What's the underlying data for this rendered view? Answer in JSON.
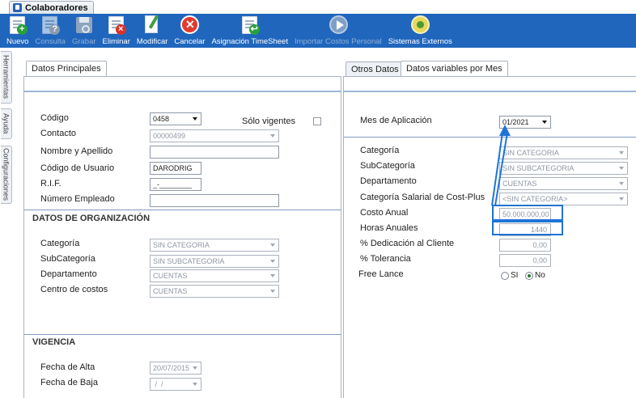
{
  "window": {
    "title": "Colaboradores"
  },
  "toolbar": [
    {
      "label": "Nuevo",
      "enabled": true,
      "icon": "new-doc-icon"
    },
    {
      "label": "Consulta",
      "enabled": false,
      "icon": "query-doc-icon"
    },
    {
      "label": "Grabar",
      "enabled": false,
      "icon": "floppy-icon"
    },
    {
      "label": "Eliminar",
      "enabled": true,
      "icon": "delete-doc-icon"
    },
    {
      "label": "Modificar",
      "enabled": true,
      "icon": "edit-pencil-icon"
    },
    {
      "label": "Cancelar",
      "enabled": true,
      "icon": "cancel-icon"
    },
    {
      "label": "Asignación TimeSheet",
      "enabled": true,
      "icon": "timesheet-icon"
    },
    {
      "label": "Importar Costos Personal",
      "enabled": false,
      "icon": "import-play-icon"
    },
    {
      "label": "Sistemas Externos",
      "enabled": true,
      "icon": "external-systems-icon"
    }
  ],
  "side_tabs": [
    "Herramientas",
    "Ayuda",
    "Configuraciones"
  ],
  "left_panel": {
    "tab": "Datos Principales",
    "codigo": {
      "label": "Código",
      "value": "0458"
    },
    "solo_vigentes": {
      "label": "Sólo vigentes",
      "checked": false
    },
    "contacto": {
      "label": "Contacto",
      "value": "00000499"
    },
    "nombre": {
      "label": "Nombre y Apellido",
      "value": ""
    },
    "codigo_usuario": {
      "label": "Código de Usuario",
      "value": "DARODRIG"
    },
    "rif": {
      "label": "R.I.F.",
      "value": "_-________"
    },
    "numero_empleado": {
      "label": "Número Empleado",
      "value": ""
    },
    "org_title": "DATOS DE ORGANIZACIÓN",
    "categoria": {
      "label": "Categoría",
      "value": "SIN CATEGORIA"
    },
    "subcategoria": {
      "label": "SubCategoría",
      "value": "SIN SUBCATEGORIA"
    },
    "departamento": {
      "label": "Departamento",
      "value": "CUENTAS"
    },
    "centro_costos": {
      "label": "Centro de costos",
      "value": "CUENTAS"
    },
    "vigencia_title": "VIGENCIA",
    "fecha_alta": {
      "label": "Fecha de Alta",
      "value": "20/07/2015"
    },
    "fecha_baja": {
      "label": "Fecha de Baja",
      "value": " /  / "
    }
  },
  "right_panel": {
    "tabs": [
      "Otros Datos",
      "Datos variables por Mes"
    ],
    "active_tab": "Datos variables por Mes",
    "mes_aplicacion": {
      "label": "Mes de Aplicación",
      "value": "01/2021"
    },
    "categoria": {
      "label": "Categoría",
      "value": "SIN CATEGORIA"
    },
    "subcategoria": {
      "label": "SubCategoría",
      "value": "SIN SUBCATEGORIA"
    },
    "departamento": {
      "label": "Departamento",
      "value": "CUENTAS"
    },
    "categoria_salarial": {
      "label": "Categoría Salarial de Cost-Plus",
      "value": "<SIN CATEGORIA>"
    },
    "costo_anual": {
      "label": "Costo Anual",
      "value": "50.000.000,00"
    },
    "horas_anuales": {
      "label": "Horas Anuales",
      "value": "1440"
    },
    "dedicacion": {
      "label": "% Dedicación al Cliente",
      "value": "0,00"
    },
    "tolerancia": {
      "label": "% Tolerancia",
      "value": "0,00"
    },
    "free_lance": {
      "label": "Free Lance",
      "options": [
        "SI",
        "No"
      ],
      "selected": "No"
    }
  },
  "colors": {
    "toolbar_bg": "#2066bd",
    "highlight": "#1f74d6"
  }
}
